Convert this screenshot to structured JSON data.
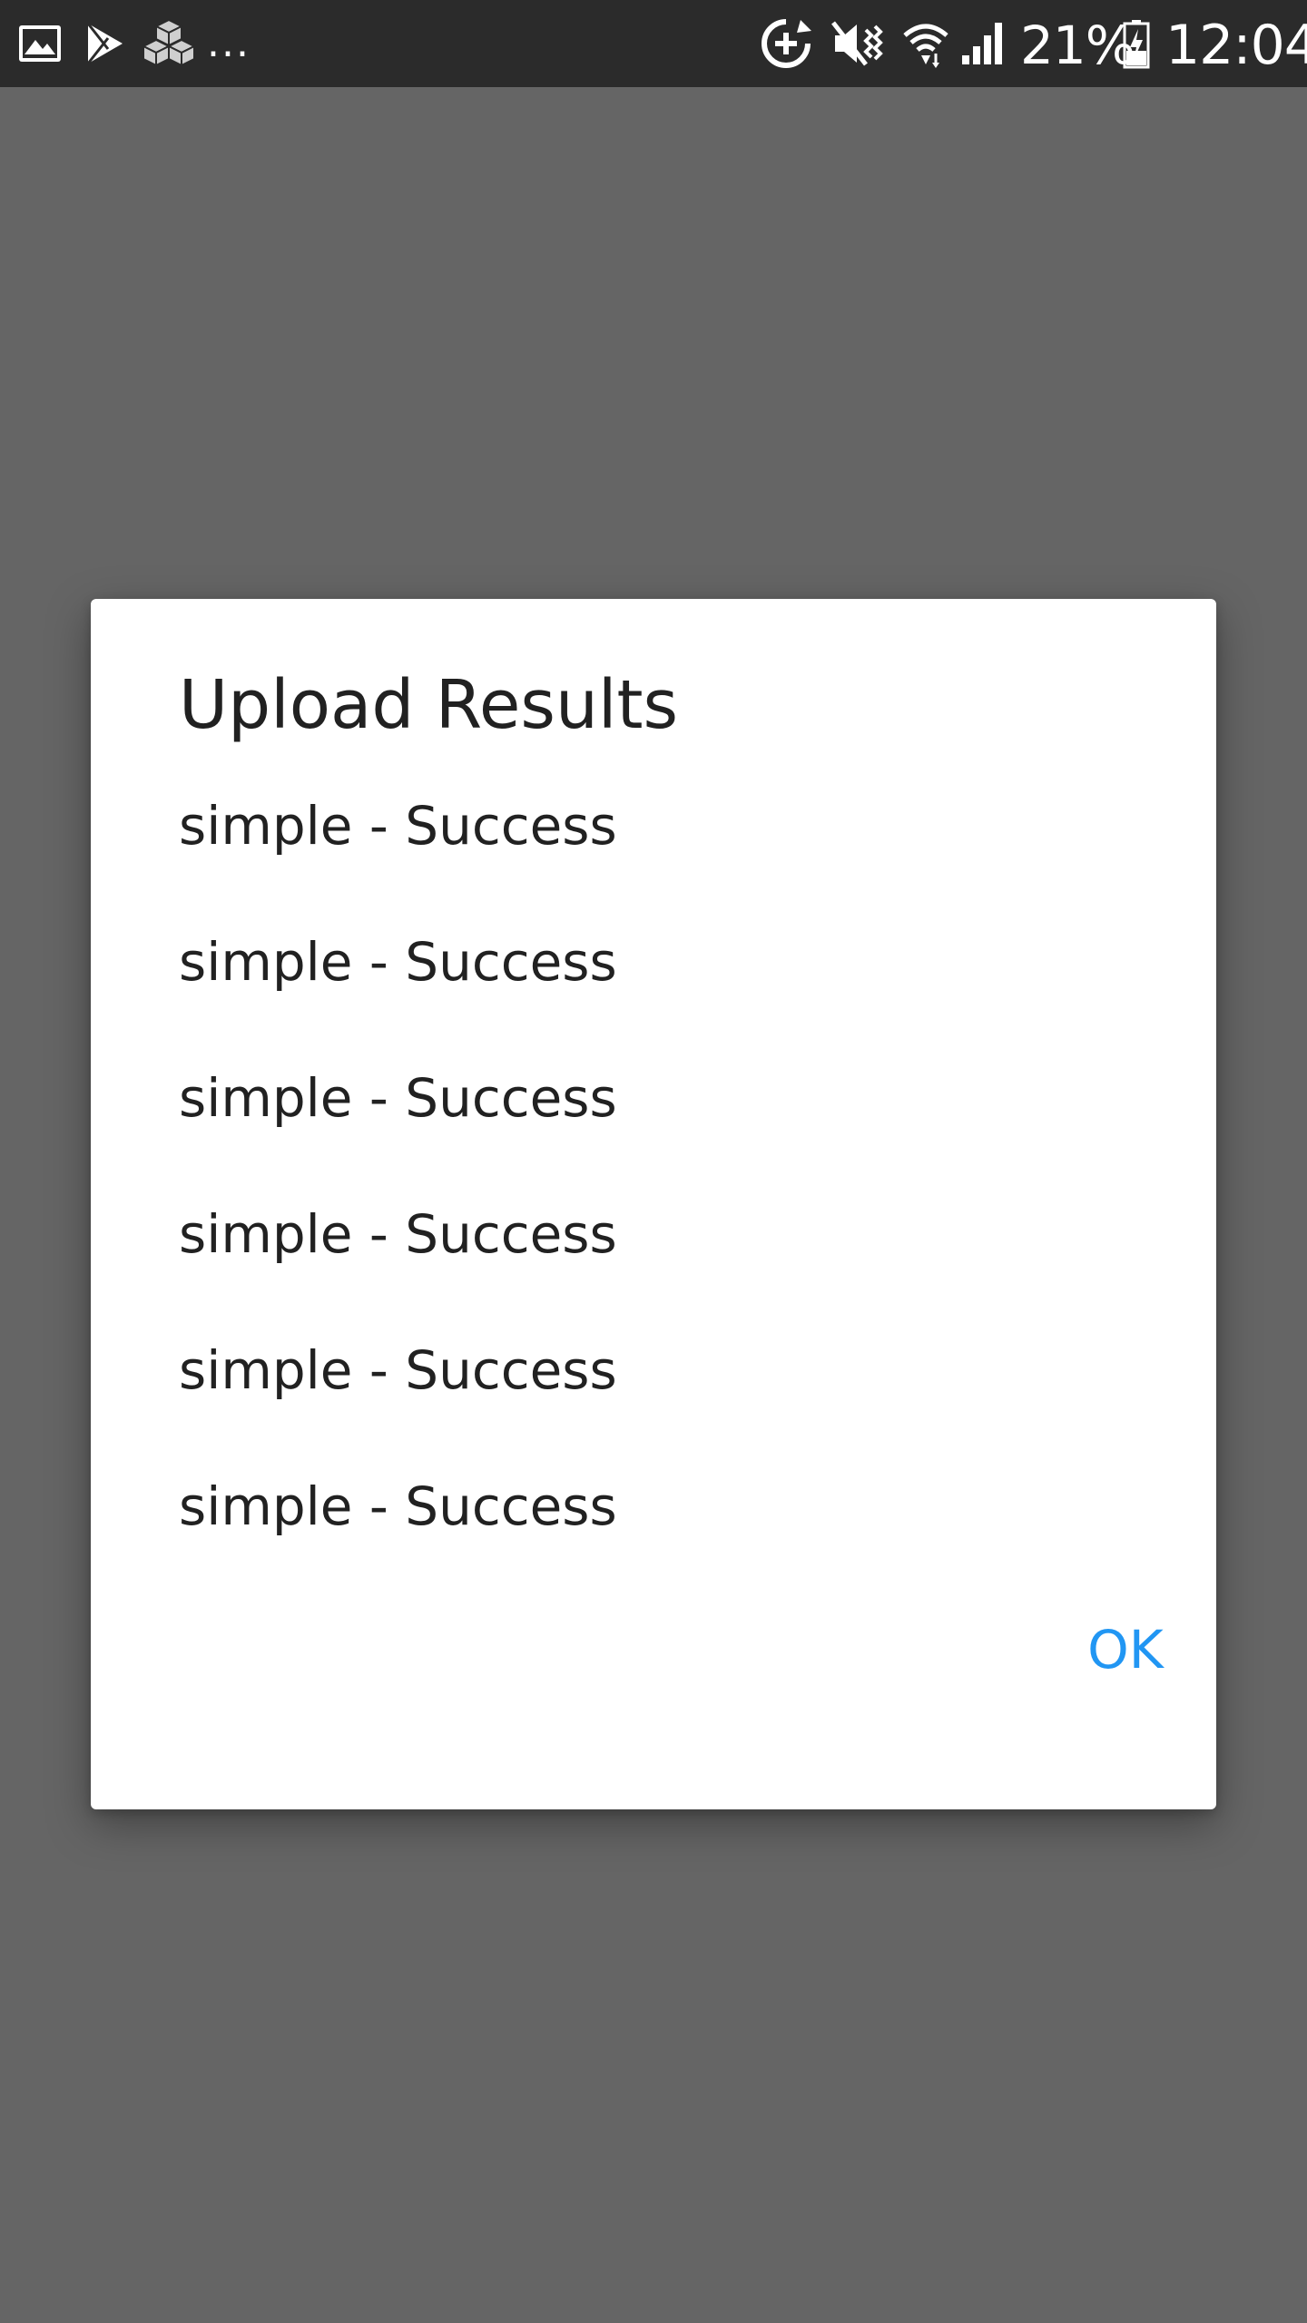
{
  "status_bar": {
    "notification_icons": [
      "gallery-icon",
      "play-store-icon",
      "cubes-icon"
    ],
    "more_indicator": "...",
    "system_icons": [
      "sync-add-icon",
      "mute-icon",
      "wifi-icon",
      "signal-icon",
      "battery-charging-icon"
    ],
    "battery_percent": "21%",
    "time": "12:04"
  },
  "dialog": {
    "title": "Upload Results",
    "results": [
      "simple - Success",
      "simple - Success",
      "simple - Success",
      "simple - Success",
      "simple - Success",
      "simple - Success"
    ],
    "ok_label": "OK"
  },
  "colors": {
    "scrim": "#656565",
    "status_bar": "#2b2b2b",
    "dialog_background": "#ffffff",
    "text_primary": "#212121",
    "accent": "#2196f3"
  }
}
